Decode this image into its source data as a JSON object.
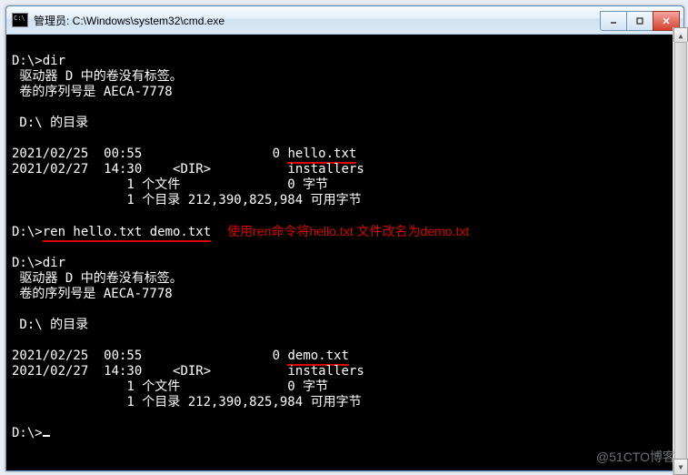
{
  "window": {
    "title": "管理员: C:\\Windows\\system32\\cmd.exe"
  },
  "prompt": "D:\\>",
  "cmd_dir": "dir",
  "cmd_ren": "ren hello.txt demo.txt",
  "annotation": "使用ren命令将hello.txt 文件改名为demo.txt",
  "vol": {
    "l1": " 驱动器 D 中的卷没有标签。",
    "l2": " 卷的序列号是 AECA-7778",
    "l3": " D:\\ 的目录"
  },
  "listing1": {
    "row1_dt": "2021/02/25  00:55",
    "row1_size": "0",
    "row1_name": "hello.txt",
    "row2_dt": "2021/02/27  14:30",
    "row2_dir": "<DIR>",
    "row2_name": "installers",
    "sum_files": "               1 个文件              0 字节",
    "sum_dirs": "               1 个目录 212,390,825,984 可用字节"
  },
  "listing2": {
    "row1_dt": "2021/02/25  00:55",
    "row1_size": "0",
    "row1_name": "demo.txt",
    "row2_dt": "2021/02/27  14:30",
    "row2_dir": "<DIR>",
    "row2_name": "installers",
    "sum_files": "               1 个文件              0 字节",
    "sum_dirs": "               1 个目录 212,390,825,984 可用字节"
  },
  "watermark": "@51CTO博客"
}
